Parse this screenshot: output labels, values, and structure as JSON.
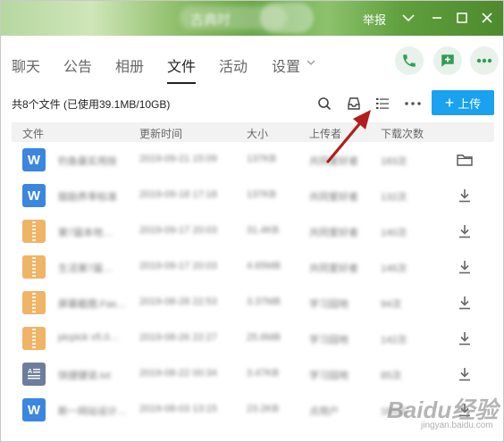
{
  "titlebar": {
    "blurred_title": "古典时",
    "report_label": "举报"
  },
  "tabs": [
    {
      "label": "聊天",
      "active": false
    },
    {
      "label": "公告",
      "active": false
    },
    {
      "label": "相册",
      "active": false
    },
    {
      "label": "文件",
      "active": true
    },
    {
      "label": "活动",
      "active": false
    },
    {
      "label": "设置",
      "active": false
    }
  ],
  "toolbar": {
    "summary": "共8个文件 (已使用39.1MB/10GB)",
    "upload_label": "上传"
  },
  "table": {
    "headers": [
      "文件",
      "更新时间",
      "大小",
      "上传者",
      "下载次数"
    ],
    "rows": [
      {
        "type": "word",
        "name": "钓鱼最实用技",
        "time": "2019-09-21 15:09",
        "size": "137KB",
        "uploader": "共同爱好者",
        "downloads": "183次",
        "action": "folder-icon"
      },
      {
        "type": "word",
        "name": "鼓励养率标准",
        "time": "2019-09-18 17:18",
        "size": "137KB",
        "uploader": "共同爱好者",
        "downloads": "132次",
        "action": "download-icon"
      },
      {
        "type": "zip",
        "name": "第7届本地…",
        "time": "2019-09-17 20:03",
        "size": "31.4KB",
        "uploader": "共同爱好者",
        "downloads": "140次",
        "action": "download-icon"
      },
      {
        "type": "zip",
        "name": "生活第7届…",
        "time": "2019-09-17 20:03",
        "size": "4.65MB",
        "uploader": "共同爱好者",
        "downloads": "146次",
        "action": "download-icon"
      },
      {
        "type": "zip",
        "name": "屏幕截图.Fas…",
        "time": "2019-08-28 22:53",
        "size": "3.37MB",
        "uploader": "学习园地",
        "downloads": "94次",
        "action": "download-icon"
      },
      {
        "type": "zip",
        "name": "picpick v5.0…",
        "time": "2019-08-26 22:27",
        "size": "25.6MB",
        "uploader": "学习园地",
        "downloads": "142次",
        "action": "download-icon"
      },
      {
        "type": "txt",
        "name": "快捷键说.txt",
        "time": "2019-08-22 00:34",
        "size": "3.47KB",
        "uploader": "学习园地",
        "downloads": "85次",
        "action": "download-icon"
      },
      {
        "type": "word",
        "name": "新一网站设计…",
        "time": "2019-08-03 13:15",
        "size": "23.2KB",
        "uploader": "点用户",
        "downloads": "183次",
        "action": "download-icon"
      }
    ]
  },
  "watermark": {
    "main": "Baidu经验",
    "sub": "jingyan.baidu.com"
  },
  "colors": {
    "accent": "#1aa1f0",
    "word": "#3b86de",
    "zip": "#f0b466",
    "txt": "#6d7d9c",
    "arrow": "#b21d1d"
  }
}
